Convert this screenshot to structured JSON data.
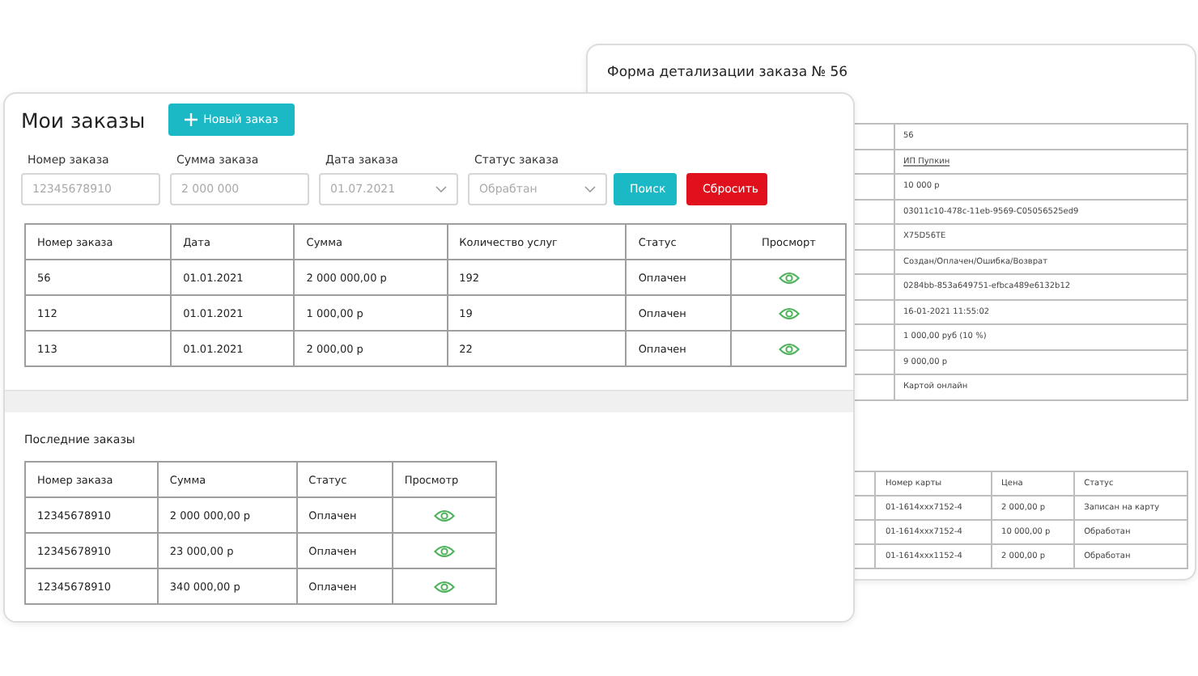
{
  "detail_form": {
    "title": "Форма детализации заказа № 56",
    "fields": [
      {
        "kind": "text",
        "value": "56"
      },
      {
        "kind": "link",
        "value": "ИП Пупкин"
      },
      {
        "kind": "text",
        "value": "10 000 р"
      },
      {
        "kind": "text",
        "value": "03011c10-478c-11eb-9569-C05056525ed9"
      },
      {
        "kind": "text",
        "value": "X75D56TE"
      },
      {
        "kind": "text",
        "value": "Создан/Оплачен/Ошибка/Возврат"
      },
      {
        "kind": "text",
        "value": "0284bb-853a649751-efbca489e6132b12"
      },
      {
        "kind": "text",
        "value": "16-01-2021 11:55:02"
      },
      {
        "kind": "text",
        "value": "1 000,00 руб (10 %)"
      },
      {
        "kind": "text",
        "value": "9 000,00 р"
      },
      {
        "kind": "text",
        "value": "Картой онлайн"
      }
    ],
    "payments": {
      "columns": [
        "Номер карты",
        "Цена",
        "Статус"
      ],
      "rows": [
        [
          "01-1614xxx7152-4",
          "2 000,00 р",
          "Записан на карту"
        ],
        [
          "01-1614xxx7152-4",
          "10 000,00 р",
          "Обработан"
        ],
        [
          "01-1614xxx1152-4",
          "2 000,00 р",
          "Обработан"
        ]
      ]
    }
  },
  "orders": {
    "title": "Мои заказы",
    "new_order_button": "Новый заказ",
    "filters": [
      {
        "kind": "input",
        "label": "Номер заказа",
        "placeholder": "12345678910"
      },
      {
        "kind": "input",
        "label": "Сумма заказа",
        "placeholder": "2 000 000"
      },
      {
        "kind": "select",
        "label": "Дата заказа",
        "placeholder": "01.07.2021"
      },
      {
        "kind": "select",
        "label": "Статус заказа",
        "placeholder": "Обрабтан"
      }
    ],
    "search_button": "Поиск",
    "reset_button": "Сбросить",
    "table": {
      "columns": [
        "Номер заказа",
        "Дата",
        "Сумма",
        "Количество услуг",
        "Статус",
        "Просморт"
      ],
      "rows": [
        [
          "56",
          "01.01.2021",
          "2 000 000,00 р",
          "192",
          "Оплачен"
        ],
        [
          "112",
          "01.01.2021",
          "1 000,00 р",
          "19",
          "Оплачен"
        ],
        [
          "113",
          "01.01.2021",
          "2 000,00 р",
          "22",
          "Оплачен"
        ]
      ]
    }
  },
  "recent_orders": {
    "title": "Последние заказы",
    "columns": [
      "Номер заказа",
      "Сумма",
      "Статус",
      "Просмотр"
    ],
    "rows": [
      [
        "12345678910",
        "2 000 000,00 р",
        "Оплачен"
      ],
      [
        "12345678910",
        "23 000,00 р",
        "Оплачен"
      ],
      [
        "12345678910",
        "340 000,00 р",
        "Оплачен"
      ]
    ]
  }
}
